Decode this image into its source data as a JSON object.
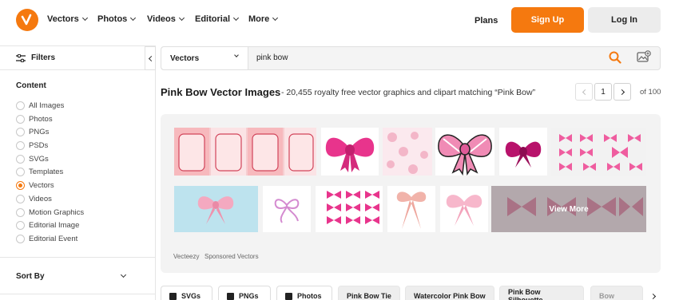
{
  "nav": {
    "items": [
      "Vectors",
      "Photos",
      "Videos",
      "Editorial",
      "More"
    ],
    "plans": "Plans",
    "signup": "Sign Up",
    "login": "Log In"
  },
  "sidebar": {
    "filters": "Filters",
    "content_title": "Content",
    "options": [
      "All Images",
      "Photos",
      "PNGs",
      "PSDs",
      "SVGs",
      "Templates",
      "Vectors",
      "Videos",
      "Motion Graphics",
      "Editorial Image",
      "Editorial Event"
    ],
    "selected": "Vectors",
    "sort_by": "Sort By"
  },
  "search": {
    "type": "Vectors",
    "query": "pink bow"
  },
  "heading": {
    "title": "Pink Bow Vector Images",
    "subtitle": "- 20,455 royalty free vector graphics and clipart matching “Pink Bow”"
  },
  "pagination": {
    "page": "1",
    "of": "of 100"
  },
  "sponsored": {
    "view_more": "View More",
    "provider": "Vecteezy",
    "label": "Sponsored Vectors"
  },
  "chips": [
    "SVGs",
    "PNGs",
    "Photos",
    "Pink Bow Tie",
    "Watercolor Pink Bow",
    "Pink Bow Silhouette",
    "Bow"
  ],
  "colors": {
    "accent": "#f5790f",
    "bow_pink": "#e8348c",
    "bow_light": "#f4a9c0"
  }
}
